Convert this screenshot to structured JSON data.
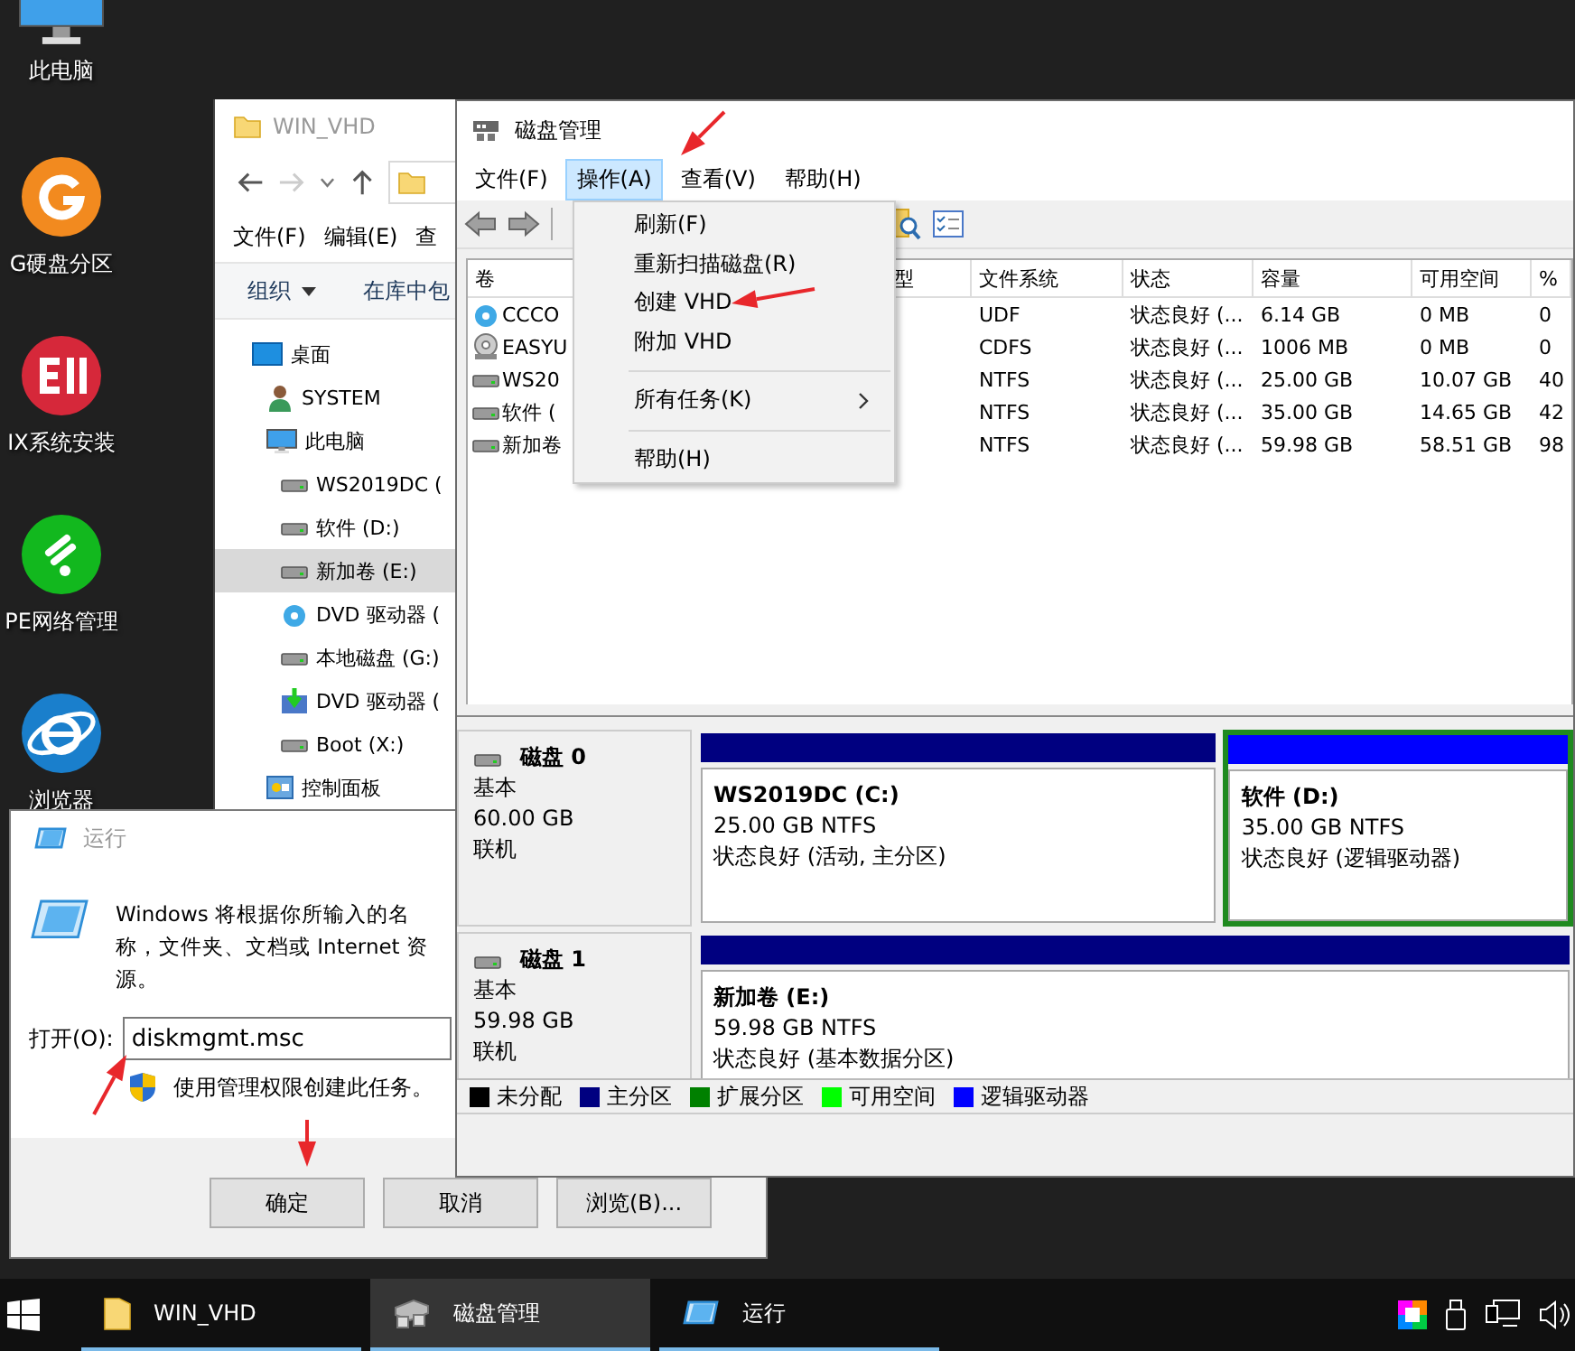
{
  "desktop_icons": [
    {
      "kind": "pc",
      "label": "此电脑"
    },
    {
      "kind": "partition",
      "label": "G硬盘分区"
    },
    {
      "kind": "installer",
      "label": "IX系统安装"
    },
    {
      "kind": "network",
      "label": "PE网络管理"
    },
    {
      "kind": "browser",
      "label": "浏览器"
    }
  ],
  "explorer": {
    "title": "WIN_VHD",
    "menu": [
      "文件(F)",
      "编辑(E)",
      "查"
    ],
    "toolbar": [
      {
        "kind": "dropdown",
        "label": "组织"
      },
      {
        "kind": "plain",
        "label": "在库中包"
      }
    ],
    "tree": [
      {
        "kind": "desktop",
        "label": "桌面",
        "selected": false,
        "children": [
          {
            "kind": "user",
            "label": "SYSTEM",
            "selected": false
          },
          {
            "kind": "pc",
            "label": "此电脑",
            "selected": false,
            "children": [
              {
                "kind": "drive",
                "label": "WS2019DC (",
                "selected": false
              },
              {
                "kind": "drive",
                "label": "软件 (D:)",
                "selected": false
              },
              {
                "kind": "drive",
                "label": "新加卷 (E:)",
                "selected": true
              },
              {
                "kind": "dvd",
                "label": "DVD 驱动器 (",
                "selected": false
              },
              {
                "kind": "drive",
                "label": "本地磁盘 (G:)",
                "selected": false
              },
              {
                "kind": "install",
                "label": "DVD 驱动器 (",
                "selected": false
              },
              {
                "kind": "drive",
                "label": "Boot (X:)",
                "selected": false
              }
            ]
          },
          {
            "kind": "panel",
            "label": "控制面板",
            "selected": false
          }
        ]
      }
    ]
  },
  "run_dialog": {
    "title": "运行",
    "description": "Windows 将根据你所输入的名称，文件夹、文档或 Internet 资源。",
    "open_label": "打开(O):",
    "command": "diskmgmt.msc",
    "admin_note": "使用管理权限创建此任务。",
    "buttons": [
      "确定",
      "取消",
      "浏览(B)..."
    ]
  },
  "disk_management": {
    "title": "磁盘管理",
    "menu": [
      {
        "label": "文件(F)",
        "selected": false
      },
      {
        "label": "操作(A)",
        "selected": true
      },
      {
        "label": "查看(V)",
        "selected": false
      },
      {
        "label": "帮助(H)",
        "selected": false
      }
    ],
    "action_menu": [
      {
        "kind": "item",
        "label": "刷新(F)"
      },
      {
        "kind": "item",
        "label": "重新扫描磁盘(R)"
      },
      {
        "kind": "item",
        "label": "创建 VHD"
      },
      {
        "kind": "item",
        "label": "附加 VHD"
      },
      {
        "kind": "separator"
      },
      {
        "kind": "submenu",
        "label": "所有任务(K)"
      },
      {
        "kind": "separator"
      },
      {
        "kind": "item",
        "label": "帮助(H)"
      }
    ],
    "table": {
      "columns": [
        "卷",
        "型",
        "文件系统",
        "状态",
        "容量",
        "可用空间",
        "%"
      ],
      "rows": [
        {
          "kind": "dvd",
          "volume": "CCCO",
          "file_system": "UDF",
          "status": "状态良好 (...",
          "capacity": "6.14 GB",
          "free_space": "0 MB",
          "percent": "0"
        },
        {
          "kind": "cd",
          "volume": "EASYU",
          "file_system": "CDFS",
          "status": "状态良好 (...",
          "capacity": "1006 MB",
          "free_space": "0 MB",
          "percent": "0"
        },
        {
          "kind": "drive",
          "volume": "WS20",
          "file_system": "NTFS",
          "status": "状态良好 (...",
          "capacity": "25.00 GB",
          "free_space": "10.07 GB",
          "percent": "40"
        },
        {
          "kind": "drive",
          "volume": "软件 (",
          "file_system": "NTFS",
          "status": "状态良好 (...",
          "capacity": "35.00 GB",
          "free_space": "14.65 GB",
          "percent": "42"
        },
        {
          "kind": "drive",
          "volume": "新加卷",
          "file_system": "NTFS",
          "status": "状态良好 (...",
          "capacity": "59.98 GB",
          "free_space": "58.51 GB",
          "percent": "98"
        }
      ]
    },
    "disks": [
      {
        "name": "磁盘 0",
        "type": "基本",
        "size": "60.00 GB",
        "state": "联机",
        "partitions": [
          {
            "kind": "primary",
            "name": "WS2019DC (C:)",
            "size": "25.00 GB NTFS",
            "status": "状态良好 (活动, 主分区)"
          },
          {
            "kind": "logical",
            "name": "软件 (D:)",
            "size": "35.00 GB NTFS",
            "status": "状态良好 (逻辑驱动器)"
          }
        ]
      },
      {
        "name": "磁盘 1",
        "type": "基本",
        "size": "59.98 GB",
        "state": "联机",
        "partitions": [
          {
            "kind": "primary",
            "name": "新加卷 (E:)",
            "size": "59.98 GB NTFS",
            "status": "状态良好 (基本数据分区)"
          }
        ]
      }
    ],
    "legend": [
      {
        "label": "未分配",
        "color": "#000000"
      },
      {
        "label": "主分区",
        "color": "#000080"
      },
      {
        "label": "扩展分区",
        "color": "#008000"
      },
      {
        "label": "可用空间",
        "color": "#00ff00"
      },
      {
        "label": "逻辑驱动器",
        "color": "#0000ff"
      }
    ]
  },
  "taskbar": {
    "items": [
      {
        "kind": "folder",
        "label": "WIN_VHD",
        "selected": false
      },
      {
        "kind": "disk",
        "label": "磁盘管理",
        "selected": true
      },
      {
        "kind": "run",
        "label": "运行",
        "selected": false
      }
    ]
  }
}
